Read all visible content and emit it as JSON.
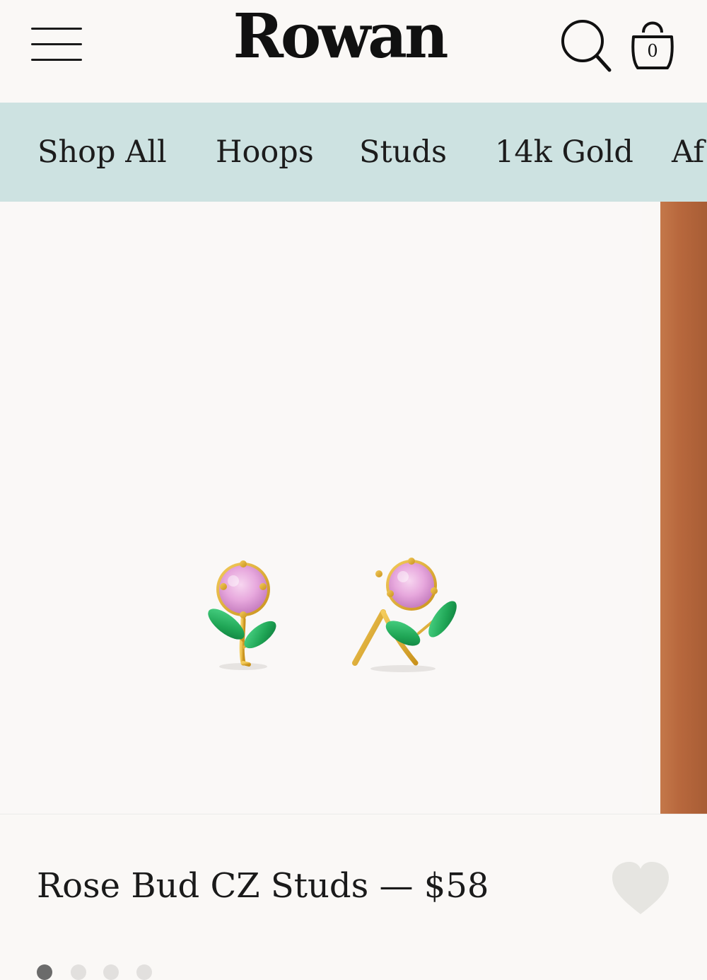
{
  "header": {
    "logo": "Rowan",
    "cart_count": "0"
  },
  "nav": {
    "items": [
      {
        "label": "Shop All"
      },
      {
        "label": "Hoops"
      },
      {
        "label": "Studs"
      },
      {
        "label": "14k Gold"
      },
      {
        "label": "Af"
      }
    ]
  },
  "gallery": {
    "slide_count": 4,
    "active_slide": 1
  },
  "product": {
    "title_price": "Rose Bud CZ Studs — $58"
  },
  "icons": [
    "menu-icon",
    "search-icon",
    "bag-icon",
    "heart-icon"
  ]
}
